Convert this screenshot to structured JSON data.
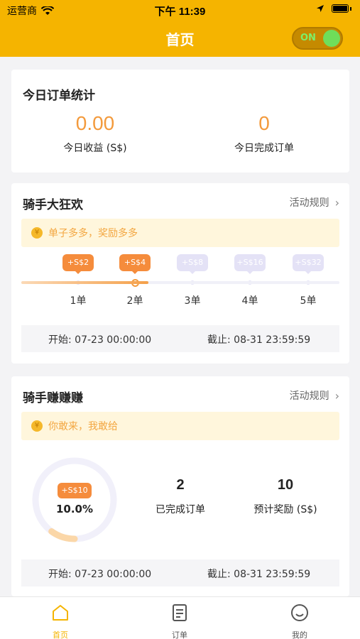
{
  "status_bar": {
    "carrier": "运营商",
    "time": "下午 11:39"
  },
  "nav": {
    "title": "首页",
    "toggle_label": "ON"
  },
  "today_stats": {
    "title": "今日订单统计",
    "income_value": "0.00",
    "income_label": "今日收益 (S$)",
    "orders_value": "0",
    "orders_label": "今日完成订单"
  },
  "carnival": {
    "title": "骑手大狂欢",
    "rule_link": "活动规则",
    "notice": "单子多多，奖励多多",
    "progress": 0.4,
    "steps": [
      {
        "reward": "+S$2",
        "label": "1单",
        "active": true
      },
      {
        "reward": "+S$4",
        "label": "2单",
        "active": true
      },
      {
        "reward": "+S$8",
        "label": "3单",
        "active": false
      },
      {
        "reward": "+S$16",
        "label": "4单",
        "active": false
      },
      {
        "reward": "+S$32",
        "label": "5单",
        "active": false
      }
    ],
    "start": "开始: 07-23 00:00:00",
    "end": "截止: 08-31 23:59:59"
  },
  "earn": {
    "title": "骑手赚赚赚",
    "rule_link": "活动规则",
    "notice": "你敢来，我敢给",
    "ring_badge": "+S$10",
    "ring_percent": "10.0%",
    "ring_progress": 0.1,
    "completed_value": "2",
    "completed_label": "已完成订单",
    "reward_value": "10",
    "reward_label": "预计奖励 (S$)",
    "start": "开始: 07-23 00:00:00",
    "end": "截止: 08-31 23:59:59"
  },
  "tabs": [
    {
      "label": "首页",
      "icon": "home-icon",
      "active": true
    },
    {
      "label": "订单",
      "icon": "orders-icon",
      "active": false
    },
    {
      "label": "我的",
      "icon": "profile-icon",
      "active": false
    }
  ],
  "colors": {
    "brand": "#f5b400",
    "accent": "#f39a3c",
    "inactive_badge": "#e4e2f6"
  }
}
